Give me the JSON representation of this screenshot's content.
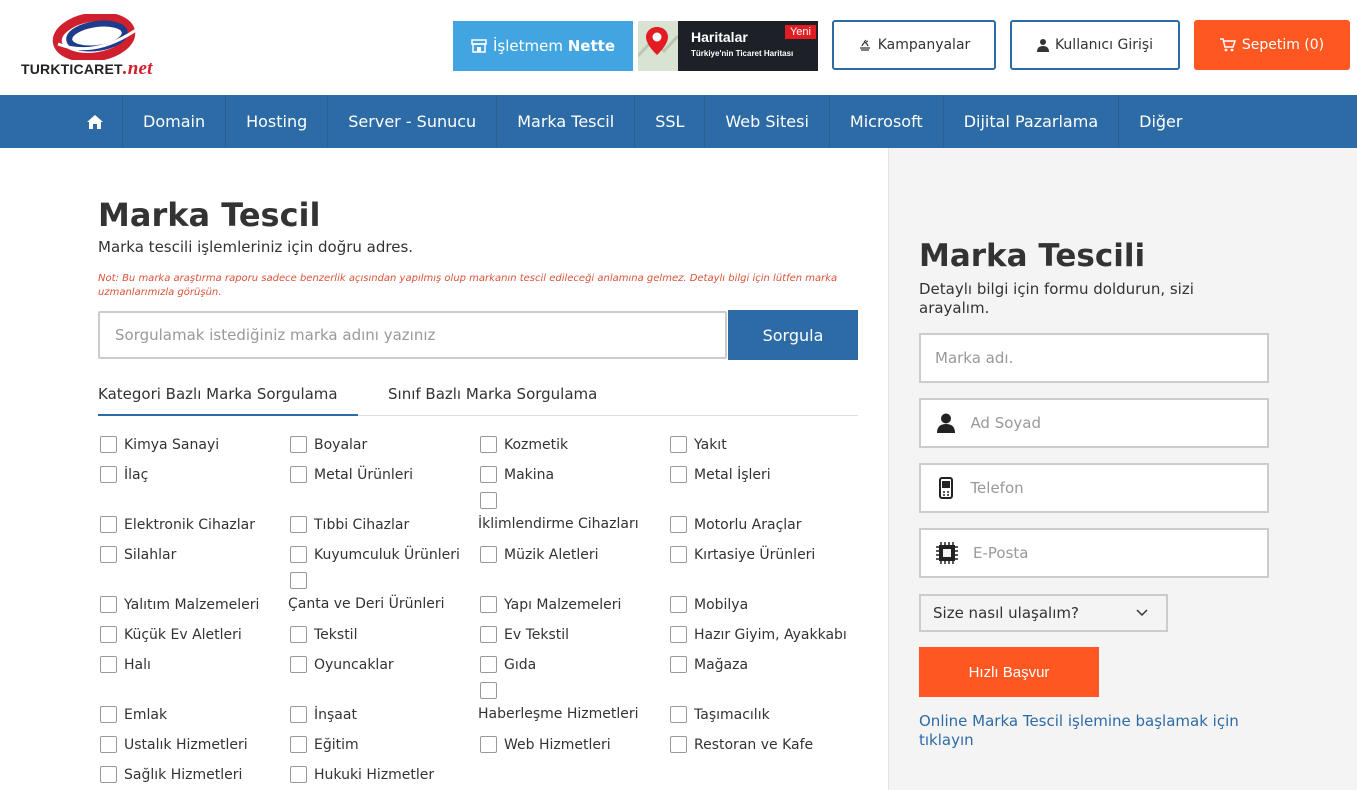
{
  "header": {
    "logo_text": "TURKTICARET",
    "logo_suffix": ".net",
    "isletme_prefix": "İşletmem ",
    "isletme_bold": "Nette",
    "haritalar_title": "Haritalar",
    "haritalar_sub": "Türkiye'nin Ticaret Haritası",
    "haritalar_badge": "Yeni",
    "kampanyalar": "Kampanyalar",
    "kullanici": "Kullanıcı Girişi",
    "sepet": "Sepetim (0)"
  },
  "nav": [
    "Domain",
    "Hosting",
    "Server - Sunucu",
    "Marka Tescil",
    "SSL",
    "Web Sitesi",
    "Microsoft",
    "Dijital Pazarlama",
    "Diğer"
  ],
  "main": {
    "title": "Marka Tescil",
    "subtitle": "Marka tescili işlemleriniz için doğru adres.",
    "note": "Not: Bu marka araştırma raporu sadece benzerlik açısından yapılmış olup markanın tescil edileceği anlamına gelmez. Detaylı bilgi için lütfen marka uzmanlarımızla görüşün.",
    "search_placeholder": "Sorgulamak istediğiniz marka adını yazınız",
    "search_button": "Sorgula",
    "tab_1": "Kategori Bazlı Marka Sorgulama",
    "tab_2": "Sınıf Bazlı Marka Sorgulama"
  },
  "categories": [
    "Kimya Sanayi",
    "Boyalar",
    "Kozmetik",
    "Yakıt",
    "İlaç",
    "Metal Ürünleri",
    "Makina",
    "Metal İşleri",
    "Elektronik Cihazlar",
    "Tıbbi Cihazlar",
    "İklimlendirme Cihazları",
    "Motorlu Araçlar",
    "Silahlar",
    "Kuyumculuk Ürünleri",
    "Müzik Aletleri",
    "Kırtasiye Ürünleri",
    "Yalıtım Malzemeleri",
    "Çanta ve Deri Ürünleri",
    "Yapı Malzemeleri",
    "Mobilya",
    "Küçük Ev Aletleri",
    "Tekstil",
    "Ev Tekstil",
    "Hazır Giyim, Ayakkabı",
    "Halı",
    "Oyuncaklar",
    "Gıda",
    "Mağaza",
    "Emlak",
    "İnşaat",
    "Haberleşme Hizmetleri",
    "Taşımacılık",
    "Ustalık Hizmetleri",
    "Eğitim",
    "Web Hizmetleri",
    "Restoran ve Kafe",
    "Sağlık Hizmetleri",
    "Hukuki Hizmetler"
  ],
  "sidebar": {
    "title": "Marka Tescili",
    "subtitle": "Detaylı bilgi için formu doldurun, sizi arayalım.",
    "marka_placeholder": "Marka adı.",
    "ad_placeholder": "Ad Soyad",
    "telefon_placeholder": "Telefon",
    "eposta_placeholder": "E-Posta",
    "select_label": "Size nasıl ulaşalım?",
    "apply_button": "Hızlı Başvur",
    "online_link": "Online Marka Tescil işlemine başlamak için tıklayın"
  },
  "colors": {
    "brand_blue": "#2d6ba7",
    "accent_orange": "#ff5722",
    "light_blue": "#42a5e1"
  }
}
